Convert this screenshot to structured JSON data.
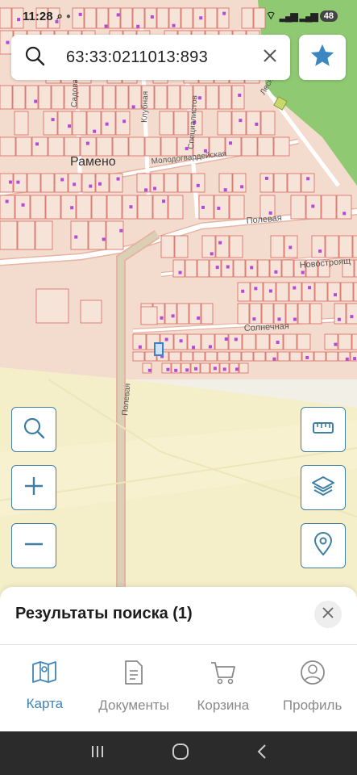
{
  "status": {
    "time": "11:28",
    "battery": "48"
  },
  "search": {
    "query": "63:33:0211013:893"
  },
  "map": {
    "labels": {
      "town": "Рамено",
      "street_molodogvardeyskaya": "Молодогвардейская",
      "street_polevaya_h": "Полевая",
      "street_polevaya_v": "Полевая",
      "street_novostroyashch": "Новостроящ",
      "street_solnechnaya": "Солнечная",
      "street_klubnaya": "Клубная",
      "street_specialistov": "Специалистов",
      "street_lesnaya": "Лесная",
      "street_sadovaya": "Садовая"
    },
    "colors": {
      "background": "#f2efe6",
      "parcel_fill": "#f6e4d8",
      "parcel_stroke": "#d8685f",
      "road": "#ffffff",
      "road_stroke": "#e7b4a4",
      "forest": "#8fca73",
      "field": "#f6f0c8",
      "marker": "#b64ad8"
    }
  },
  "results": {
    "title": "Результаты поиска (1)"
  },
  "tabs": [
    {
      "label": "Карта",
      "icon": "map-icon",
      "active": true
    },
    {
      "label": "Документы",
      "icon": "document-icon",
      "active": false
    },
    {
      "label": "Корзина",
      "icon": "cart-icon",
      "active": false
    },
    {
      "label": "Профиль",
      "icon": "profile-icon",
      "active": false
    }
  ],
  "colors": {
    "accent": "#3f85b8",
    "star": "#3a87c2",
    "button_border": "#3f7fa3"
  }
}
